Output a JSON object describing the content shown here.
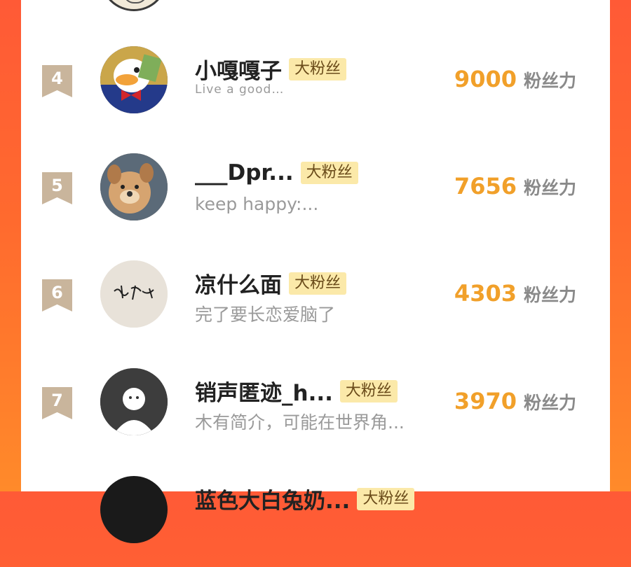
{
  "ranking": {
    "rows": [
      {
        "rank": "4",
        "name": "小嘎嘎子",
        "badge": "大粉丝",
        "bio": "Live a good…",
        "score": "9000",
        "score_unit": "粉丝力"
      },
      {
        "rank": "5",
        "name": "___Dpr...",
        "badge": "大粉丝",
        "bio": "keep happy:...",
        "score": "7656",
        "score_unit": "粉丝力"
      },
      {
        "rank": "6",
        "name": "凉什么面",
        "badge": "大粉丝",
        "bio": "完了要长恋爱脑了",
        "score": "4303",
        "score_unit": "粉丝力"
      },
      {
        "rank": "7",
        "name": "销声匿迹_h...",
        "badge": "大粉丝",
        "bio": "木有简介，可能在世界角...",
        "score": "3970",
        "score_unit": "粉丝力"
      },
      {
        "name": "蓝色大白兔奶...",
        "badge": "大粉丝"
      }
    ]
  },
  "colors": {
    "background_gradient": [
      "#ff5a36",
      "#ff8a2a"
    ],
    "rank_ribbon": "#c9b59c",
    "score": "#f1a02a",
    "badge_bg": "#fbe9a9"
  },
  "icons": {
    "avatar_4": "duck-cartoon-avatar",
    "avatar_5": "dog-photo-avatar",
    "avatar_6": "handwriting-avatar",
    "avatar_7": "default-person-avatar"
  }
}
